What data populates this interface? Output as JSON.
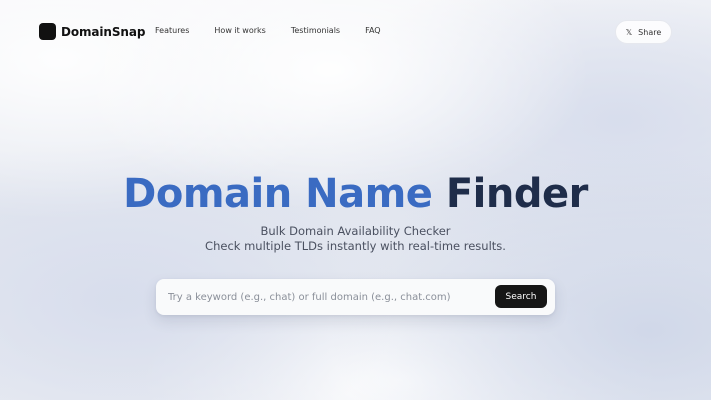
{
  "brand": {
    "name": "DomainSnap",
    "logo_icon": "square-logo-icon"
  },
  "nav": {
    "items": [
      {
        "label": "Features"
      },
      {
        "label": "How it works"
      },
      {
        "label": "Testimonials"
      },
      {
        "label": "FAQ"
      }
    ]
  },
  "share": {
    "icon": "x-logo-icon",
    "icon_glyph": "𝕏",
    "label": "Share"
  },
  "hero": {
    "title_part1": "Domain Name",
    "title_part2": "Finder",
    "subtitle_line1": "Bulk Domain Availability Checker",
    "subtitle_line2": "Check multiple TLDs instantly with real-time results."
  },
  "search": {
    "placeholder": "Try a keyword (e.g., chat) or full domain (e.g., chat.com)",
    "value": "",
    "button_label": "Search"
  },
  "colors": {
    "title_accent": "#3a6bc2",
    "title_dark": "#1f2d4a",
    "button_bg": "#161616"
  }
}
